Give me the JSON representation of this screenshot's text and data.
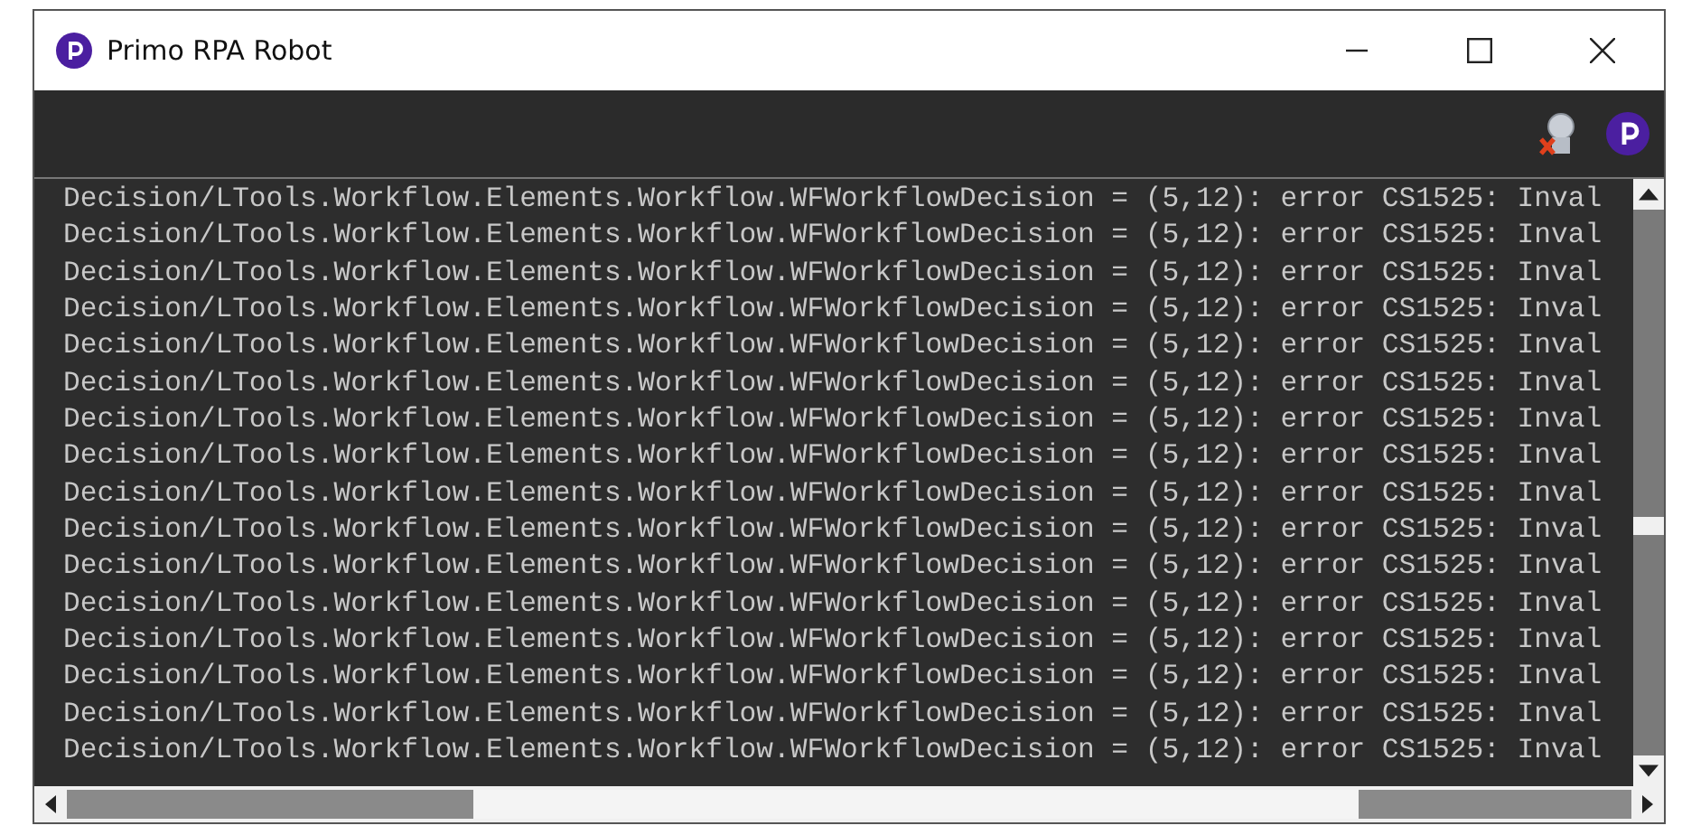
{
  "window": {
    "title": "Primo RPA Robot"
  },
  "log": {
    "lines": [
      "Decision/LTools.Workflow.Elements.Workflow.WFWorkflowDecision = (5,12): error CS1525: Inval",
      "Decision/LTools.Workflow.Elements.Workflow.WFWorkflowDecision = (5,12): error CS1525: Inval",
      "Decision/LTools.Workflow.Elements.Workflow.WFWorkflowDecision = (5,12): error CS1525: Inval",
      "Decision/LTools.Workflow.Elements.Workflow.WFWorkflowDecision = (5,12): error CS1525: Inval",
      "Decision/LTools.Workflow.Elements.Workflow.WFWorkflowDecision = (5,12): error CS1525: Inval",
      "Decision/LTools.Workflow.Elements.Workflow.WFWorkflowDecision = (5,12): error CS1525: Inval",
      "Decision/LTools.Workflow.Elements.Workflow.WFWorkflowDecision = (5,12): error CS1525: Inval",
      "Decision/LTools.Workflow.Elements.Workflow.WFWorkflowDecision = (5,12): error CS1525: Inval",
      "Decision/LTools.Workflow.Elements.Workflow.WFWorkflowDecision = (5,12): error CS1525: Inval",
      "Decision/LTools.Workflow.Elements.Workflow.WFWorkflowDecision = (5,12): error CS1525: Inval",
      "Decision/LTools.Workflow.Elements.Workflow.WFWorkflowDecision = (5,12): error CS1525: Inval",
      "Decision/LTools.Workflow.Elements.Workflow.WFWorkflowDecision = (5,12): error CS1525: Inval",
      "Decision/LTools.Workflow.Elements.Workflow.WFWorkflowDecision = (5,12): error CS1525: Inval",
      "Decision/LTools.Workflow.Elements.Workflow.WFWorkflowDecision = (5,12): error CS1525: Inval",
      "Decision/LTools.Workflow.Elements.Workflow.WFWorkflowDecision = (5,12): error CS1525: Inval",
      "Decision/LTools.Workflow.Elements.Workflow.WFWorkflowDecision = (5,12): error CS1525: Inval"
    ]
  }
}
